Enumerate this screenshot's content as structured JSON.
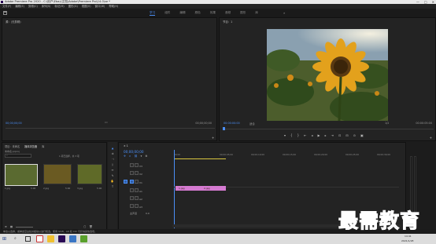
{
  "window": {
    "title": "Adobe Premiere Pro 2020 - C:\\用户\\Ebay\\文档\\Adobe\\Premiere Pro\\14.0\\se *",
    "controls": [
      "—",
      "□",
      "✕"
    ]
  },
  "menubar": [
    "文件(F)",
    "编辑(E)",
    "剪辑(C)",
    "序列(S)",
    "标记(M)",
    "图形(G)",
    "视图(V)",
    "窗口(W)",
    "帮助(H)"
  ],
  "workspaces": {
    "tabs": [
      "学习",
      "组件",
      "编辑",
      "颜色",
      "效果",
      "音频",
      "图形",
      "库"
    ],
    "active_index": 0,
    "more": "»"
  },
  "source": {
    "title": "源：(无剪辑)",
    "timecode_left": "00;00;00;00",
    "timecode_right": "00;00;00;00"
  },
  "program": {
    "title": "节目：1",
    "timecode_left": "00:00:00:00",
    "fit": "适合",
    "fraction": "1/2",
    "timecode_right": "00:00:05:00"
  },
  "project": {
    "tabs": [
      "项目：未命名",
      "媒体浏览器",
      "库"
    ],
    "active_index": 1,
    "path": "未命名.prproj",
    "item_count": "1 项已选择，共 3 项",
    "items": [
      {
        "name": "1.jpg",
        "duration": "5:00"
      },
      {
        "name": "2.jpg",
        "duration": "5:00"
      },
      {
        "name": "3.jpg",
        "duration": "5:00"
      }
    ]
  },
  "timeline": {
    "title": "1",
    "timecode": "00;00;00;00",
    "ruler_ticks": [
      "00;00",
      "00;00;05;00",
      "00;00;10;00",
      "00;00;15;00",
      "00;00;20;00",
      "00;00;25;00",
      "00;00;30;00"
    ],
    "tracks": [
      {
        "id": "V3"
      },
      {
        "id": "V2"
      },
      {
        "id": "V1"
      },
      {
        "id": "A1"
      },
      {
        "id": "A2"
      },
      {
        "id": "A3"
      }
    ],
    "master": {
      "label": "主声道",
      "value": "0.0"
    },
    "clips": [
      {
        "name": "1.jpg",
        "track": "V1",
        "start": 0,
        "end": 5
      },
      {
        "name": "2.jpg",
        "track": "V1",
        "start": 5,
        "end": 10
      }
    ]
  },
  "status": "单击以选择，或单击空白处并拖动以进行框选。使用 Shift、Alt 和 Ctrl 可获得其他选项。",
  "taskbar": {
    "time": "14:41",
    "date": "2021/1/28"
  },
  "watermark": "最需教育",
  "colors": {
    "accent": "#4b8ff7",
    "clip": "#d57ad1",
    "watermark": "#1a3bb5"
  }
}
